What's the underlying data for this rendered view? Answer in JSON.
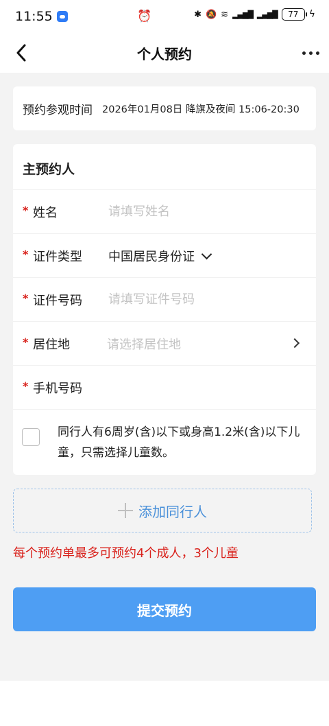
{
  "status_bar": {
    "time": "11:55",
    "battery": "77"
  },
  "nav": {
    "title": "个人预约"
  },
  "visit_time": {
    "label": "预约参观时间",
    "value": "2026年01月08日 降旗及夜间 15:06-20:30"
  },
  "main_booker": {
    "section_title": "主预约人",
    "name": {
      "label": "姓名",
      "placeholder": "请填写姓名",
      "required_mark": "*"
    },
    "id_type": {
      "label": "证件类型",
      "value": "中国居民身份证",
      "required_mark": "*"
    },
    "id_number": {
      "label": "证件号码",
      "placeholder": "请填写证件号码",
      "required_mark": "*"
    },
    "residence": {
      "label": "居住地",
      "placeholder": "请选择居住地",
      "required_mark": "*"
    },
    "phone": {
      "label": "手机号码",
      "placeholder": "",
      "required_mark": "*"
    },
    "child_option": "同行人有6周岁(含)以下或身高1.2米(含)以下儿童，只需选择儿童数。"
  },
  "add_companion": {
    "label": "添加同行人"
  },
  "limit_note": "每个预约单最多可预约4个成人，3个儿童",
  "submit": {
    "label": "提交预约"
  },
  "colors": {
    "accent": "#4e9ef3",
    "required": "#d9211b",
    "background": "#f3f3f3"
  }
}
